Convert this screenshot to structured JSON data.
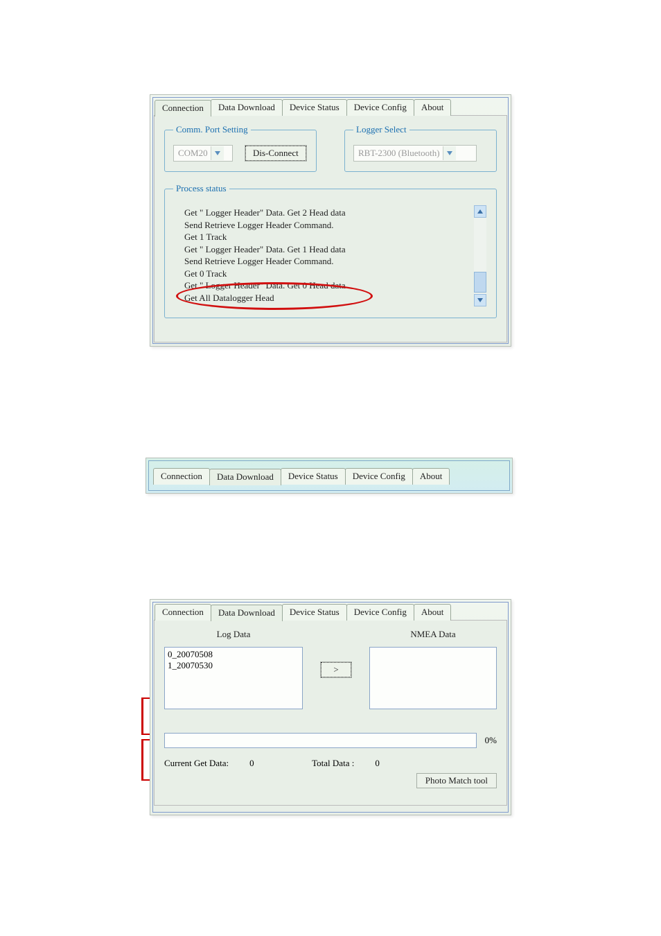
{
  "panel1": {
    "tabs": [
      "Connection",
      "Data Download",
      "Device Status",
      "Device Config",
      "About"
    ],
    "active_tab_index": 0,
    "comm_port_legend": "Comm. Port Setting",
    "logger_select_legend": "Logger Select",
    "com_port_value": "COM20",
    "disconnect_label": "Dis-Connect",
    "logger_value": "RBT-2300 (Bluetooth)",
    "process_legend": "Process status",
    "process_lines": [
      "Get \" Logger Header\" Data. Get 2 Head data",
      "Send Retrieve Logger Header Command.",
      "Get 1 Track",
      "Get \" Logger Header\" Data. Get 1 Head data",
      "Send Retrieve Logger Header Command.",
      "Get 0 Track",
      "Get \" Logger Header\" Data. Get 0 Head data",
      "Get All Datalogger Head"
    ]
  },
  "panel2": {
    "tabs": [
      "Connection",
      "Data Download",
      "Device Status",
      "Device Config",
      "About"
    ],
    "active_tab_index": 1
  },
  "panel3": {
    "tabs": [
      "Connection",
      "Data Download",
      "Device Status",
      "Device Config",
      "About"
    ],
    "active_tab_index": 1,
    "log_data_heading": "Log Data",
    "nmea_data_heading": "NMEA Data",
    "log_items": [
      "0_20070508",
      "1_20070530"
    ],
    "transfer_button": ">",
    "progress_percent": "0%",
    "current_get_label": "Current Get Data:",
    "current_get_value": "0",
    "total_label": "Total Data :",
    "total_value": "0",
    "photo_match_label": "Photo Match tool"
  }
}
